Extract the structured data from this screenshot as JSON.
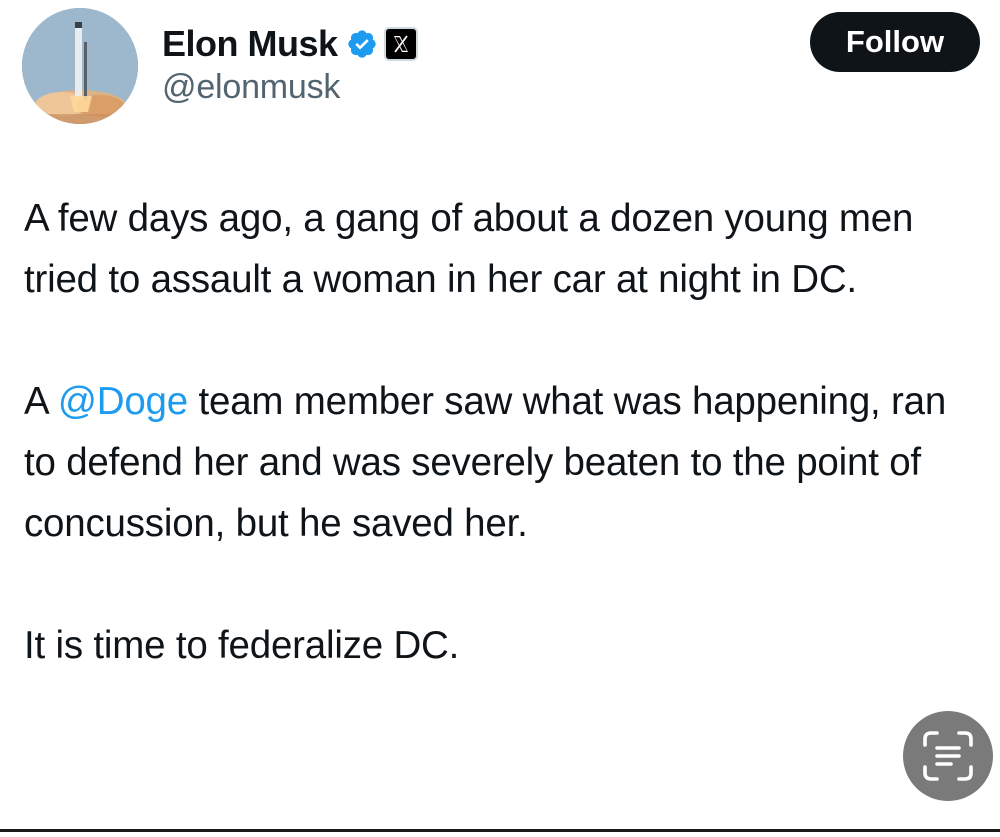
{
  "author": {
    "display_name": "Elon Musk",
    "handle": "@elonmusk",
    "verified": true,
    "affiliate_badge": "x-logo-icon",
    "avatar": "rocket-launch-avatar"
  },
  "actions": {
    "follow_label": "Follow"
  },
  "tweet": {
    "para1": "A few days ago, a gang of about a dozen young men tried to assault a woman in her car at night in DC.",
    "para2_prefix": "A ",
    "para2_mention": "@Doge",
    "para2_suffix": " team member saw what was happening, ran to defend her and was severely beaten to the point of concussion, but he saved her.",
    "para3": "It is time to federalize DC."
  },
  "overlay": {
    "live_text_icon": "live-text-icon"
  },
  "colors": {
    "text": "#0f1419",
    "secondary_text": "#536471",
    "mention": "#1d9bf0",
    "verified_badge": "#1d9bf0",
    "follow_button_bg": "#0f1419",
    "live_text_button_bg": "#7a7a7a"
  }
}
